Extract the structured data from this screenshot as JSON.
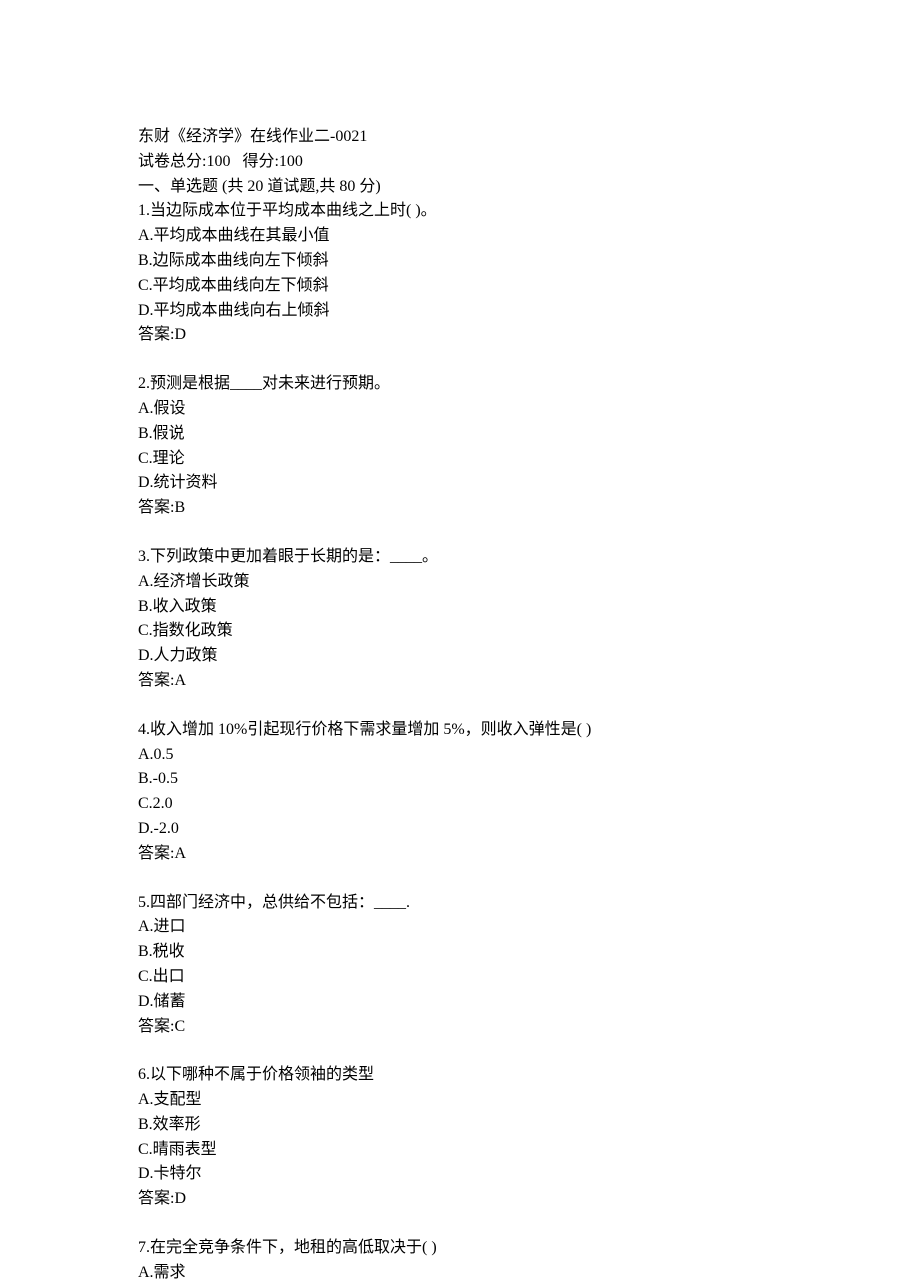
{
  "header": {
    "title": "东财《经济学》在线作业二-0021",
    "scoreLine": "试卷总分:100   得分:100"
  },
  "section": {
    "heading": "一、单选题 (共 20 道试题,共 80 分)"
  },
  "questions": [
    {
      "num": "1.",
      "stem": "当边际成本位于平均成本曲线之上时( )。",
      "options": [
        "A.平均成本曲线在其最小值",
        "B.边际成本曲线向左下倾斜",
        "C.平均成本曲线向左下倾斜",
        "D.平均成本曲线向右上倾斜"
      ],
      "answer": "答案:D"
    },
    {
      "num": "2.",
      "stem": "预测是根据____对未来进行预期。",
      "options": [
        "A.假设",
        "B.假说",
        "C.理论",
        "D.统计资料"
      ],
      "answer": "答案:B"
    },
    {
      "num": "3.",
      "stem": "下列政策中更加着眼于长期的是：____。",
      "options": [
        "A.经济增长政策",
        "B.收入政策",
        "C.指数化政策",
        "D.人力政策"
      ],
      "answer": "答案:A"
    },
    {
      "num": "4.",
      "stem": "收入增加 10%引起现行价格下需求量增加 5%，则收入弹性是( )",
      "options": [
        "A.0.5",
        "B.-0.5",
        "C.2.0",
        "D.-2.0"
      ],
      "answer": "答案:A"
    },
    {
      "num": "5.",
      "stem": "四部门经济中，总供给不包括：____.",
      "options": [
        "A.进口",
        "B.税收",
        "C.出口",
        "D.储蓄"
      ],
      "answer": "答案:C"
    },
    {
      "num": "6.",
      "stem": "以下哪种不属于价格领袖的类型",
      "options": [
        "A.支配型",
        "B.效率形",
        "C.晴雨表型",
        "D.卡特尔"
      ],
      "answer": "答案:D"
    },
    {
      "num": "7.",
      "stem": "在完全竞争条件下，地租的高低取决于( )",
      "options": [
        "A.需求"
      ],
      "answer": ""
    }
  ]
}
